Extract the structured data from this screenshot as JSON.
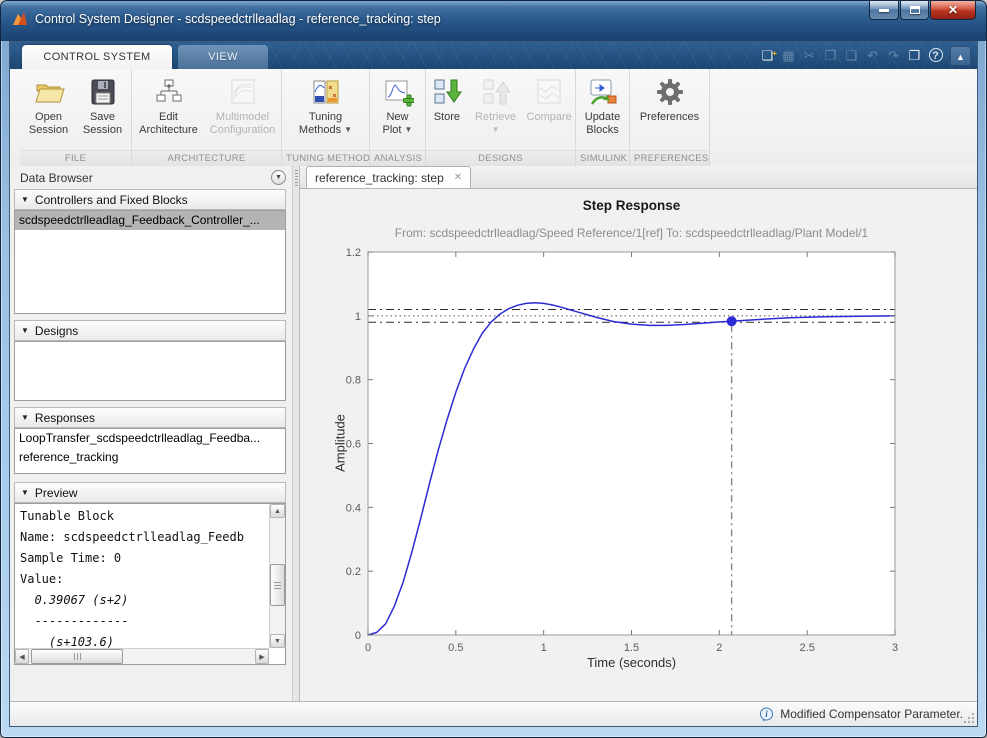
{
  "window": {
    "title": "Control System Designer - scdspeedctrlleadlag - reference_tracking: step"
  },
  "ribbon": {
    "tabs": [
      {
        "label": "CONTROL SYSTEM"
      },
      {
        "label": "VIEW"
      }
    ],
    "quick_access": [
      {
        "name": "new-figure",
        "glyph": "❏"
      },
      {
        "name": "save",
        "glyph": "▦"
      },
      {
        "name": "cut",
        "glyph": "✂"
      },
      {
        "name": "copy",
        "glyph": "❐"
      },
      {
        "name": "paste",
        "glyph": "❑"
      },
      {
        "name": "undo",
        "glyph": "↶"
      },
      {
        "name": "redo",
        "glyph": "↷"
      },
      {
        "name": "window-layout",
        "glyph": "❒"
      },
      {
        "name": "help",
        "glyph": "?"
      },
      {
        "name": "minimize-ribbon",
        "glyph": "▲"
      }
    ],
    "groups": [
      {
        "label": "FILE",
        "buttons": [
          {
            "line1": "Open",
            "line2": "Session"
          },
          {
            "line1": "Save",
            "line2": "Session"
          }
        ]
      },
      {
        "label": "ARCHITECTURE",
        "buttons": [
          {
            "line1": "Edit",
            "line2": "Architecture"
          },
          {
            "line1": "Multimodel",
            "line2": "Configuration"
          }
        ]
      },
      {
        "label": "TUNING METHODS",
        "buttons": [
          {
            "line1": "Tuning",
            "line2": "Methods"
          }
        ]
      },
      {
        "label": "ANALYSIS",
        "buttons": [
          {
            "line1": "New",
            "line2": "Plot"
          }
        ]
      },
      {
        "label": "DESIGNS",
        "buttons": [
          {
            "line1": "Store",
            "line2": ""
          },
          {
            "line1": "Retrieve",
            "line2": ""
          },
          {
            "line1": "Compare",
            "line2": ""
          }
        ]
      },
      {
        "label": "SIMULINK",
        "buttons": [
          {
            "line1": "Update",
            "line2": "Blocks"
          }
        ]
      },
      {
        "label": "PREFERENCES",
        "buttons": [
          {
            "line1": "Preferences",
            "line2": ""
          }
        ]
      }
    ]
  },
  "data_browser": {
    "title": "Data Browser",
    "sections": {
      "controllers": {
        "title": "Controllers and Fixed Blocks",
        "items": [
          {
            "text": "scdspeedctrlleadlag_Feedback_Controller_..."
          }
        ]
      },
      "designs": {
        "title": "Designs"
      },
      "responses": {
        "title": "Responses",
        "items": [
          {
            "text": "LoopTransfer_scdspeedctrlleadlag_Feedba..."
          },
          {
            "text": "reference_tracking"
          }
        ]
      },
      "preview": {
        "title": "Preview",
        "lines": [
          "Tunable Block",
          "Name: scdspeedctrlleadlag_Feedb",
          "Sample Time: 0",
          "Value:",
          "  0.39067 (s+2)",
          "  -------------",
          "    (s+103.6)"
        ]
      }
    }
  },
  "document": {
    "tab_label": "reference_tracking: step"
  },
  "status_bar": {
    "message": "Modified Compensator Parameter."
  },
  "colors": {
    "curve": "#2b2bd4",
    "titlebar_blue": "#2c5c90",
    "ribbon_navy": "#1c4672",
    "selection_gray": "#b4b4b4"
  },
  "chart_data": {
    "type": "line",
    "title": "Step Response",
    "subtitle": "From: scdspeedctrlleadlag/Speed Reference/1[ref]  To: scdspeedctrlleadlag/Plant Model/1",
    "xlabel": "Time (seconds)",
    "ylabel": "Amplitude",
    "xlim": [
      0,
      3
    ],
    "ylim": [
      0,
      1.2
    ],
    "xticks": [
      0,
      0.5,
      1,
      1.5,
      2,
      2.5,
      3
    ],
    "yticks": [
      0,
      0.2,
      0.4,
      0.6,
      0.8,
      1,
      1.2
    ],
    "grid": false,
    "legend": "none",
    "series": [
      {
        "name": "reference_tracking",
        "color": "#2b2bd4",
        "x": [
          0,
          0.05,
          0.1,
          0.15,
          0.2,
          0.25,
          0.3,
          0.35,
          0.4,
          0.45,
          0.5,
          0.55,
          0.6,
          0.65,
          0.7,
          0.75,
          0.8,
          0.85,
          0.9,
          0.95,
          1.0,
          1.05,
          1.1,
          1.15,
          1.2,
          1.3,
          1.4,
          1.5,
          1.6,
          1.7,
          1.8,
          1.9,
          2.0,
          2.07,
          2.2,
          2.4,
          2.6,
          2.8,
          3.0
        ],
        "y": [
          0,
          0.008,
          0.035,
          0.09,
          0.165,
          0.26,
          0.365,
          0.475,
          0.58,
          0.675,
          0.76,
          0.835,
          0.895,
          0.945,
          0.98,
          1.005,
          1.022,
          1.033,
          1.039,
          1.041,
          1.039,
          1.034,
          1.027,
          1.019,
          1.011,
          0.995,
          0.982,
          0.974,
          0.97,
          0.97,
          0.973,
          0.977,
          0.981,
          0.983,
          0.988,
          0.994,
          0.997,
          0.999,
          1.0
        ]
      }
    ],
    "reference_lines": {
      "steady_state": 1.0,
      "settling_upper": 1.02,
      "settling_lower": 0.98
    },
    "settling_marker": {
      "x": 2.07,
      "y": 0.983
    }
  }
}
